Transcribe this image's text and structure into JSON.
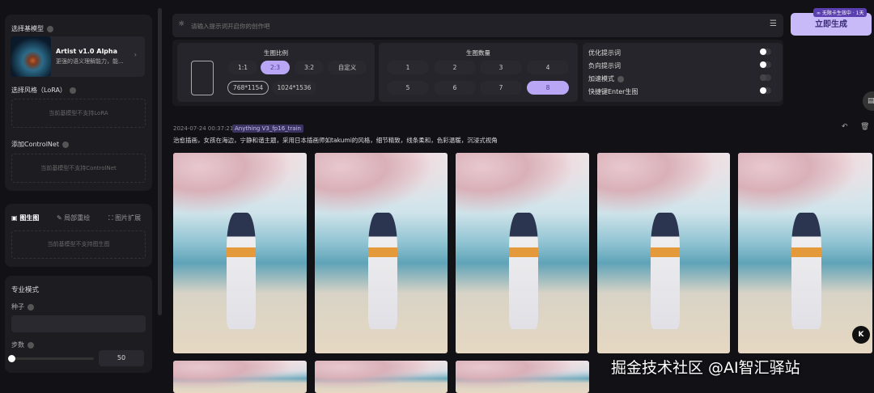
{
  "sidebar": {
    "base_model_label": "选择基模型",
    "model_name": "Artist v1.0 Alpha",
    "model_desc": "更强的语义理解能力，能...",
    "lora_label": "选择风格（LoRA）",
    "lora_empty": "当前基模型不支持LoRA",
    "controlnet_label": "添加ControlNet",
    "controlnet_empty": "当前基模型不支持ControlNet",
    "tabs": [
      {
        "label": "图生图"
      },
      {
        "label": "局部重绘"
      },
      {
        "label": "图片扩展"
      }
    ],
    "img2img_empty": "当前基模型不支持图生图",
    "pro_title": "专业模式",
    "seed_label": "种子",
    "steps_label": "步数",
    "steps_value": "50",
    "steps_fraction": 0
  },
  "prompt": {
    "placeholder": "请输入提示词开启你的创作吧"
  },
  "ratio": {
    "title": "生图比例",
    "options": [
      "1:1",
      "2:3",
      "3:2",
      "自定义"
    ],
    "selected": "2:3",
    "sizes": [
      "768*1154",
      "1024*1536"
    ],
    "selected_size": "768*1154"
  },
  "quantity": {
    "title": "生图数量",
    "options": [
      "1",
      "2",
      "3",
      "4",
      "5",
      "6",
      "7",
      "8"
    ],
    "selected": "8"
  },
  "toggles": [
    {
      "label": "优化提示词",
      "on": false
    },
    {
      "label": "负向提示词",
      "on": false
    },
    {
      "label": "加速模式",
      "on": false,
      "disabled": true
    },
    {
      "label": "快捷键Enter生图",
      "on": false
    }
  ],
  "generate": {
    "label": "立即生成",
    "badge": "∞ 无限卡生效中 · 1天"
  },
  "record": {
    "timestamp": "2024-07-24 00:37:21",
    "model_tag": "Anything V3_fp16_train",
    "prompt": "治愈插画，女孩在海边，宁静和谐主题，采用日本插画师如takumi的风格，细节精致，线条柔和，色彩温暖，沉浸式视角"
  },
  "watermark": "掘金技术社区 @AI智汇驿站"
}
